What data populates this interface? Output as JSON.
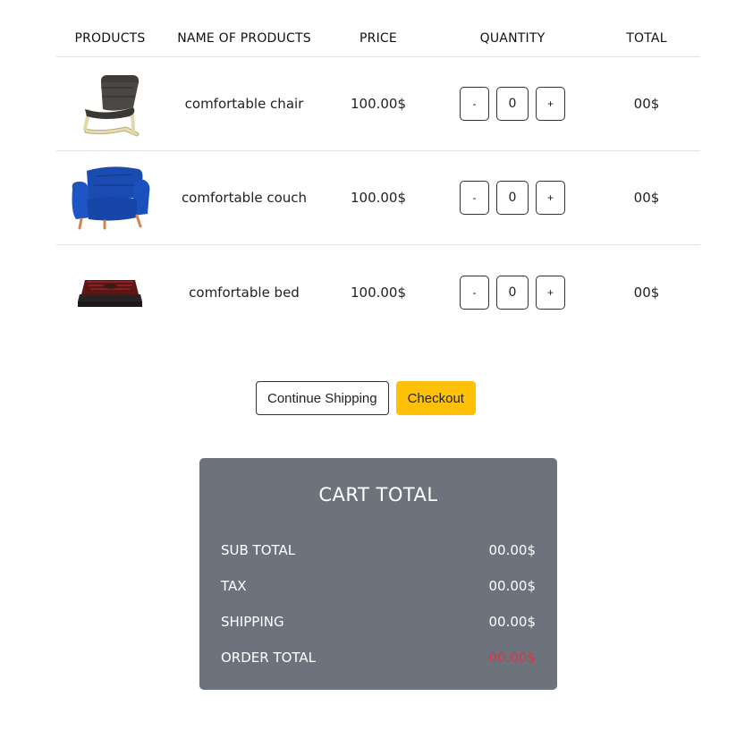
{
  "headers": [
    "PRODUCTS",
    "NAME OF PRODUCTS",
    "PRICE",
    "QUANTITY",
    "TOTAL"
  ],
  "items": [
    {
      "image_icon": "armchair-icon",
      "name": "comfortable chair",
      "price": "100.00$",
      "minus": "-",
      "quantity": "0",
      "plus": "+",
      "total": "00$"
    },
    {
      "image_icon": "sofa-chair-icon",
      "name": "comfortable couch",
      "price": "100.00$",
      "minus": "-",
      "quantity": "0",
      "plus": "+",
      "total": "00$"
    },
    {
      "image_icon": "bed-icon",
      "name": "comfortable bed",
      "price": "100.00$",
      "minus": "-",
      "quantity": "0",
      "plus": "+",
      "total": "00$"
    }
  ],
  "actions": {
    "continue_label": "Continue Shipping",
    "checkout_label": "Checkout"
  },
  "cart_total": {
    "title": "CART TOTAL",
    "rows": [
      {
        "label": "SUB TOTAL",
        "value": "00.00$"
      },
      {
        "label": "TAX",
        "value": "00.00$"
      },
      {
        "label": "SHIPPING",
        "value": "00.00$"
      },
      {
        "label": "ORDER TOTAL",
        "value": "00.00$"
      }
    ]
  },
  "colors": {
    "checkout": "#ffc107",
    "panel": "#6c737c",
    "order_total": "#dc3545"
  }
}
